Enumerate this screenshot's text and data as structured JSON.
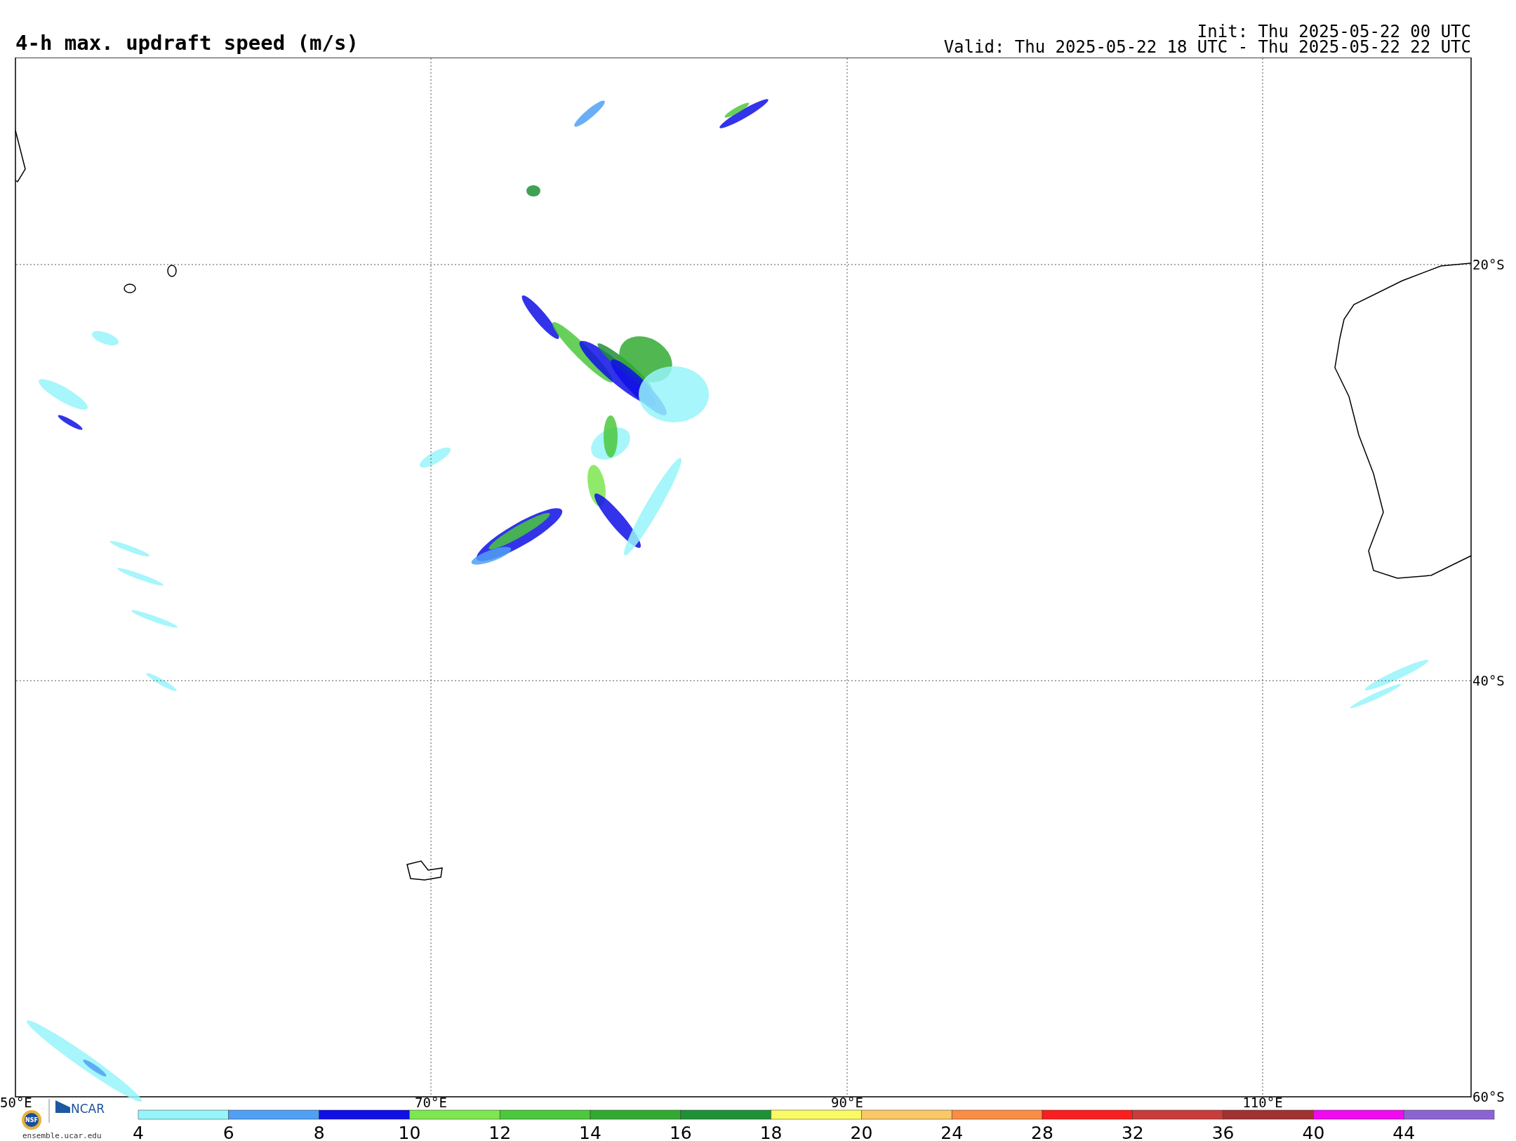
{
  "title": "4-h max. updraft speed (m/s)",
  "init": "Init: Thu 2025-05-22 00 UTC",
  "valid": "Valid: Thu 2025-05-22 18 UTC - Thu 2025-05-22 22 UTC",
  "map": {
    "lat_labels": [
      "20°S",
      "40°S",
      "60°S"
    ],
    "lon_labels": [
      "50°E",
      "70°E",
      "90°E",
      "110°E"
    ]
  },
  "colorbar": {
    "segments": [
      {
        "label": "4",
        "color": "#96f5fa"
      },
      {
        "label": "6",
        "color": "#50a0f5"
      },
      {
        "label": "8",
        "color": "#0f0fe6"
      },
      {
        "label": "10",
        "color": "#7de650"
      },
      {
        "label": "12",
        "color": "#4bc83c"
      },
      {
        "label": "14",
        "color": "#32aa32"
      },
      {
        "label": "16",
        "color": "#1e9137"
      },
      {
        "label": "18",
        "color": "#fafa64"
      },
      {
        "label": "20",
        "color": "#fac864"
      },
      {
        "label": "24",
        "color": "#fa8c46"
      },
      {
        "label": "28",
        "color": "#fa1e1e"
      },
      {
        "label": "32",
        "color": "#c83c3c"
      },
      {
        "label": "36",
        "color": "#a03232"
      },
      {
        "label": "40",
        "color": "#f00af0"
      },
      {
        "label": "44",
        "color": "#8c64d2"
      }
    ]
  },
  "logo": {
    "seal": "NSF",
    "org": "NCAR",
    "url": "ensemble.ucar.edu"
  }
}
